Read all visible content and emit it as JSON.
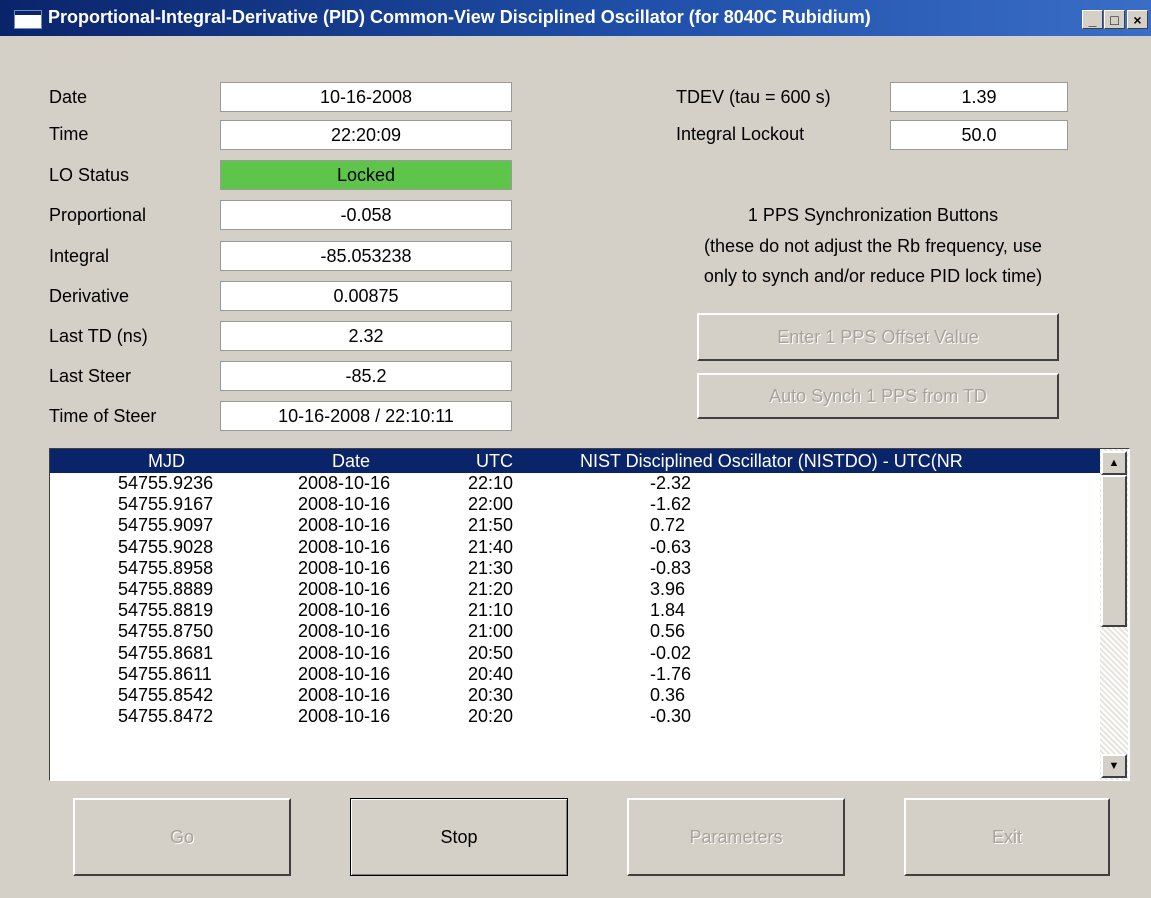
{
  "window": {
    "title": "Proportional-Integral-Derivative (PID) Common-View Disciplined Oscillator (for 8040C Rubidium)",
    "icon": "app-window-icon",
    "controls": {
      "minimize": "_",
      "maximize": "□",
      "close": "×"
    }
  },
  "status": {
    "date": {
      "label": "Date",
      "value": "10-16-2008"
    },
    "time": {
      "label": "Time",
      "value": "22:20:09"
    },
    "lo_status": {
      "label": "LO Status",
      "value": "Locked",
      "color": "#5ec44a"
    },
    "proportional": {
      "label": "Proportional",
      "value": "-0.058"
    },
    "integral": {
      "label": "Integral",
      "value": "-85.053238"
    },
    "derivative": {
      "label": "Derivative",
      "value": "0.00875"
    },
    "last_td": {
      "label": "Last TD (ns)",
      "value": "2.32"
    },
    "last_steer": {
      "label": "Last Steer",
      "value": "-85.2"
    },
    "time_of_steer": {
      "label": "Time of Steer",
      "value": "10-16-2008 / 22:10:11"
    }
  },
  "right_panel": {
    "tdev": {
      "label": "TDEV (tau = 600 s)",
      "value": "1.39"
    },
    "integral_lockout": {
      "label": "Integral Lockout",
      "value": "50.0"
    },
    "sync_heading": "1 PPS Synchronization Buttons",
    "sync_note_line1": "(these do not adjust the Rb frequency, use",
    "sync_note_line2": "only to synch and/or reduce PID lock time)",
    "enter_offset_button": "Enter 1 PPS Offset Value",
    "auto_synch_button": "Auto Synch 1 PPS from TD"
  },
  "table": {
    "headers": [
      "MJD",
      "Date",
      "UTC",
      "NIST Disciplined Oscillator (NISTDO) - UTC(NR"
    ],
    "rows": [
      [
        "54755.9236",
        "2008-10-16",
        "22:10",
        "-2.32"
      ],
      [
        "54755.9167",
        "2008-10-16",
        "22:00",
        "-1.62"
      ],
      [
        "54755.9097",
        "2008-10-16",
        "21:50",
        "0.72"
      ],
      [
        "54755.9028",
        "2008-10-16",
        "21:40",
        "-0.63"
      ],
      [
        "54755.8958",
        "2008-10-16",
        "21:30",
        "-0.83"
      ],
      [
        "54755.8889",
        "2008-10-16",
        "21:20",
        "3.96"
      ],
      [
        "54755.8819",
        "2008-10-16",
        "21:10",
        "1.84"
      ],
      [
        "54755.8750",
        "2008-10-16",
        "21:00",
        "0.56"
      ],
      [
        "54755.8681",
        "2008-10-16",
        "20:50",
        "-0.02"
      ],
      [
        "54755.8611",
        "2008-10-16",
        "20:40",
        "-1.76"
      ],
      [
        "54755.8542",
        "2008-10-16",
        "20:30",
        "0.36"
      ],
      [
        "54755.8472",
        "2008-10-16",
        "20:20",
        "-0.30"
      ]
    ],
    "scroll_up_icon": "▲",
    "scroll_down_icon": "▼"
  },
  "buttons": {
    "go": "Go",
    "stop": "Stop",
    "parameters": "Parameters",
    "exit": "Exit"
  }
}
